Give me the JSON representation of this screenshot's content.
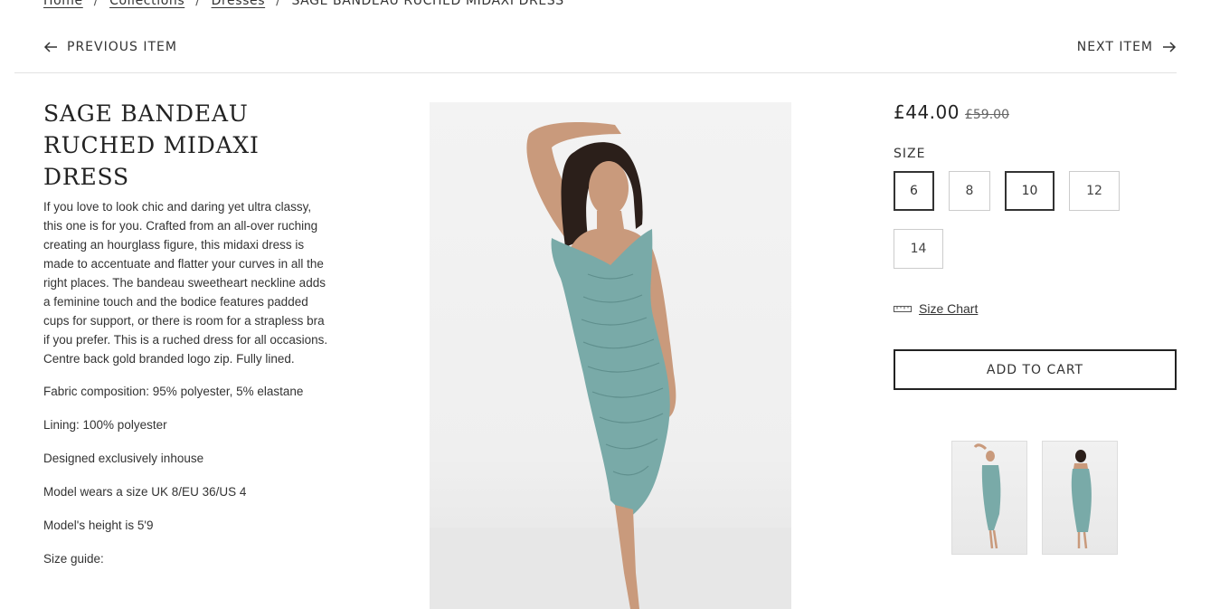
{
  "breadcrumb": {
    "home": "Home",
    "collections": "Collections",
    "dresses": "Dresses",
    "current": "SAGE BANDEAU RUCHED MIDAXI DRESS",
    "separator": "/"
  },
  "nav": {
    "previous": "PREVIOUS ITEM",
    "next": "NEXT ITEM"
  },
  "product": {
    "title": "SAGE BANDEAU RUCHED MIDAXI DRESS",
    "description": "If you love to look chic and daring yet ultra classy, this one is for you.  Crafted from an all-over ruching creating an hourglass figure, this midaxi dress is made to accentuate and flatter your curves in all the right places.  The bandeau sweetheart neckline adds a feminine touch and the bodice features padded cups for support, or there is room for a strapless bra if you prefer.  This is a ruched dress for all occasions.  Centre back gold branded logo zip.  Fully lined.",
    "details": [
      "Fabric composition: 95% polyester, 5% elastane",
      "Lining: 100% polyester",
      "Designed exclusively inhouse",
      "Model wears a size UK 8/EU 36/US 4",
      "Model's height is 5'9",
      "Size guide:"
    ],
    "price": "£44.00",
    "old_price": "£59.00",
    "size_label": "SIZE",
    "sizes": [
      "6",
      "8",
      "10",
      "12",
      "14"
    ],
    "size_chart": "Size Chart",
    "add_to_cart": "ADD TO CART"
  },
  "colors": {
    "dress": "#79aaa8",
    "skin": "#c99a7c",
    "hair": "#2b1f1a",
    "text": "#222222",
    "border": "#cccccc"
  },
  "icons": {
    "prev": "arrow-left-icon",
    "next": "arrow-right-icon",
    "size_chart": "ruler-icon"
  }
}
